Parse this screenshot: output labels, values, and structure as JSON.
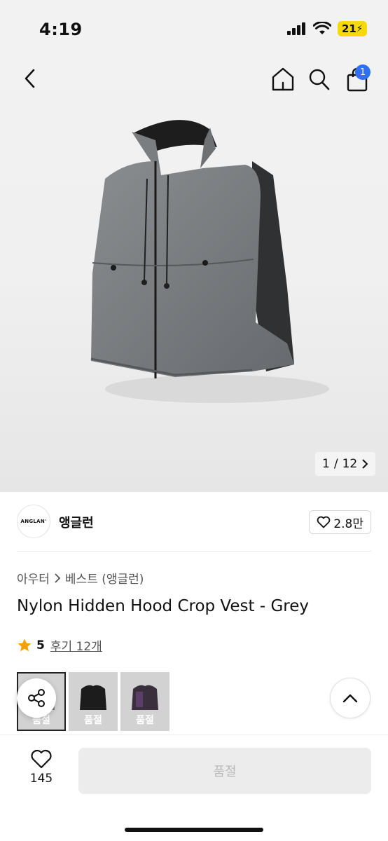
{
  "status_bar": {
    "time": "4:19",
    "battery": "21"
  },
  "nav": {
    "cart_count": "1"
  },
  "gallery": {
    "current": "1",
    "separator": "/",
    "total": "12"
  },
  "brand": {
    "logo_text": "ANGLAN'",
    "name": "앵글런",
    "likes": "2.8만"
  },
  "breadcrumb": {
    "category": "아우터",
    "subcategory": "베스트 (앵글런)"
  },
  "product": {
    "title": "Nylon Hidden Hood Crop Vest - Grey"
  },
  "rating": {
    "score": "5",
    "reviews_label": "후기 12개"
  },
  "variants": [
    {
      "label": "품절",
      "color": "#7a7a7a",
      "selected": true
    },
    {
      "label": "품절",
      "color": "#1c1c1c",
      "selected": false
    },
    {
      "label": "품절",
      "color": "#3a2f3c",
      "selected": false
    }
  ],
  "bottom": {
    "wish_count": "145",
    "action_label": "품절"
  },
  "colors": {
    "accent_blue": "#2f6ff2",
    "battery_yellow": "#f5d90a",
    "star": "#f5a000"
  },
  "icons": [
    "back-icon",
    "home-icon",
    "search-icon",
    "cart-icon",
    "heart-icon",
    "star-icon",
    "share-icon",
    "chevron-up-icon",
    "chevron-right-icon",
    "signal-icon",
    "wifi-icon"
  ]
}
